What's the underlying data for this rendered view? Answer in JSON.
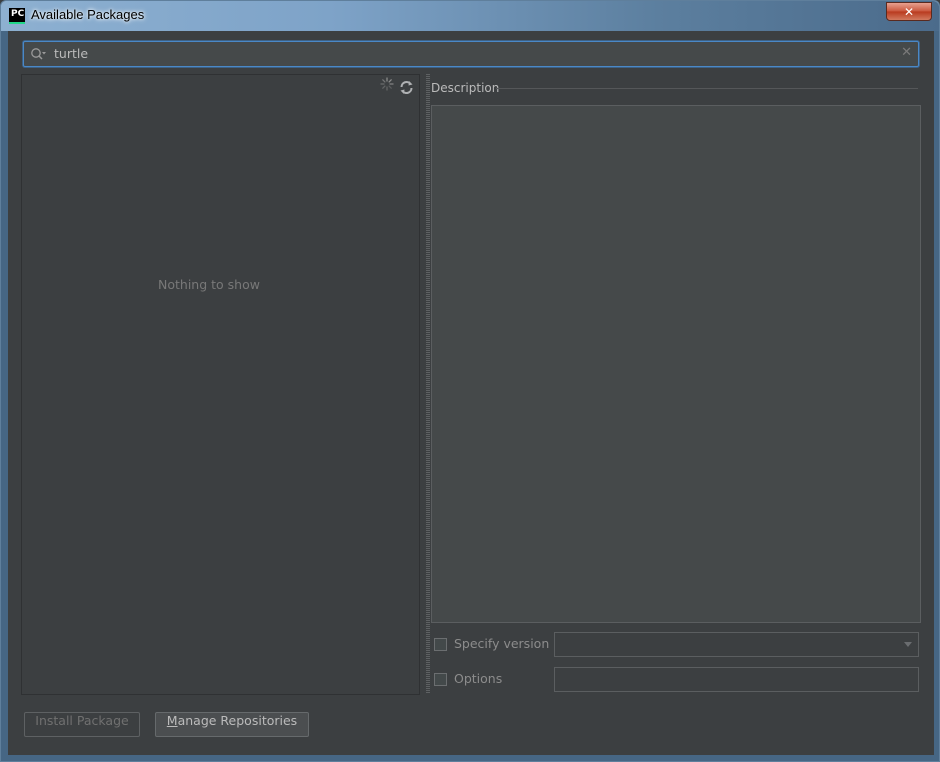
{
  "window": {
    "title": "Available Packages",
    "app_icon_text": "PC",
    "close_glyph": "✕"
  },
  "search": {
    "value": "turtle",
    "icon": "search-icon",
    "clear_icon": "close-icon"
  },
  "package_list": {
    "empty_text": "Nothing to show",
    "loading_icon": "spinner-icon",
    "refresh_icon": "refresh-icon"
  },
  "description": {
    "label": "Description",
    "text": ""
  },
  "options": {
    "specify_version_label": "Specify version",
    "specify_version_checked": false,
    "version_value": "",
    "options_label": "Options",
    "options_checked": false,
    "options_value": ""
  },
  "buttons": {
    "install_label": "Install Package",
    "install_enabled": false,
    "manage_mnemonic": "M",
    "manage_rest": "anage Repositories"
  },
  "colors": {
    "background": "#3c3f41",
    "focus_border": "#4a88c7",
    "text": "#bbbbbb",
    "muted_text": "#787878"
  }
}
